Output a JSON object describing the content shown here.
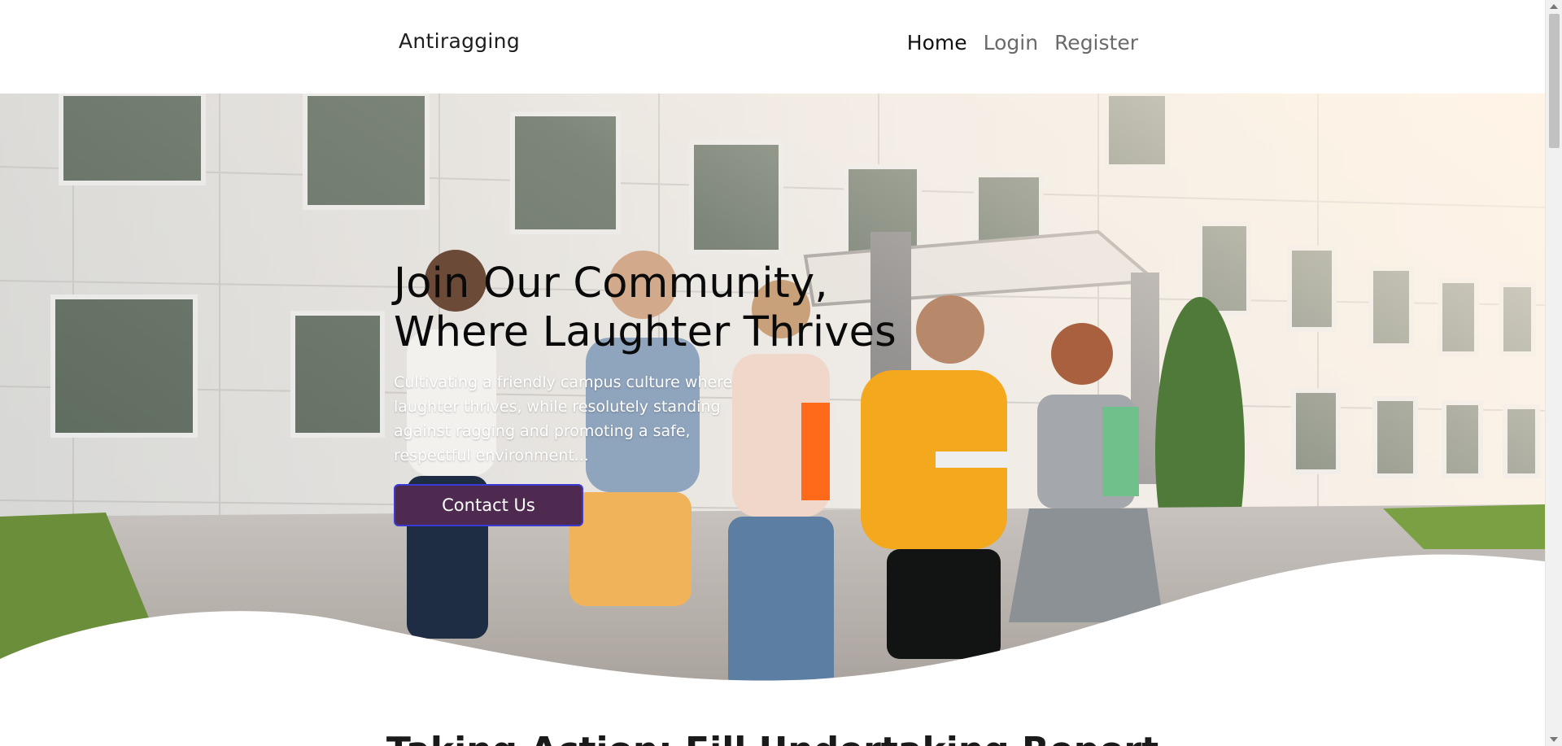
{
  "header": {
    "brand": "Antiragging",
    "nav": [
      {
        "label": "Home",
        "active": true
      },
      {
        "label": "Login",
        "active": false
      },
      {
        "label": "Register",
        "active": false
      }
    ]
  },
  "hero": {
    "title_line1": "Join Our Community,",
    "title_line2": "Where Laughter Thrives",
    "description": "Cultivating a friendly campus culture where laughter thrives, while resolutely standing against ragging and promoting a safe, respectful environment...",
    "cta_label": "Contact Us",
    "image": "students-walking-campus-photo"
  },
  "next_section": {
    "title": "Taking Action: Fill Undertaking Report"
  },
  "colors": {
    "button_bg": "#4f2a50",
    "button_border": "#3b3bd3",
    "nav_active": "#111111",
    "nav_inactive": "#6a6a6a"
  }
}
